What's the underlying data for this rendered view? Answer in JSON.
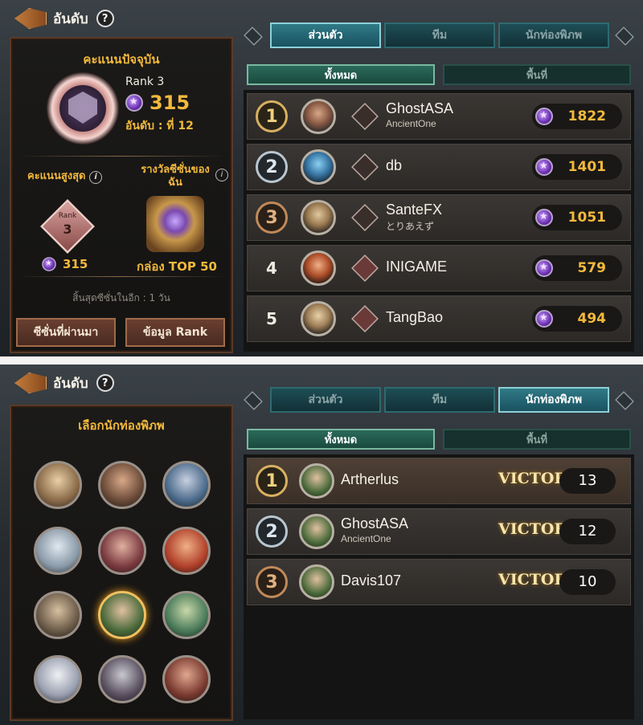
{
  "colors": {
    "gold": "#f3b93c",
    "tab_active": "#2f7a86",
    "victory": "#f6e6b0"
  },
  "icons": {
    "back": "back-arrow-icon",
    "help": "question-icon",
    "currency": "purple-star-gem-icon"
  },
  "panel1": {
    "header": {
      "title": "อันดับ",
      "help": "?"
    },
    "current_score_title": "คะแนนปัจจุบัน",
    "rank_label": "Rank 3",
    "score": "315",
    "position": "อันดับ : ที่ 12",
    "highest_score_label": "คะแนนสูงสุด",
    "season_reward_label": "รางวัลซีซั่นของฉัน",
    "info": "i",
    "badge_rank_label": "Rank",
    "badge_rank_number": "3",
    "highest_score": "315",
    "reward_name": "กล่อง TOP 50",
    "season_end": "สิ้นสุดซีซั่นในอีก : 1 วัน",
    "btn_past_seasons": "ซีซั่นที่ผ่านมา",
    "btn_rank_info": "ข้อมูล Rank",
    "tabs": [
      "ส่วนตัว",
      "ทีม",
      "นักท่องพิภพ"
    ],
    "subtabs": [
      "ทั้งหมด",
      "พื้นที่"
    ],
    "rows": [
      {
        "rank": "1",
        "name": "GhostASA",
        "sub": "AncientOne",
        "score": "1822"
      },
      {
        "rank": "2",
        "name": "db",
        "sub": "",
        "score": "1401"
      },
      {
        "rank": "3",
        "name": "SanteFX",
        "sub": "とりあえず",
        "score": "1051"
      },
      {
        "rank": "4",
        "name": "INIGAME",
        "sub": "",
        "score": "579"
      },
      {
        "rank": "5",
        "name": "TangBao",
        "sub": "",
        "score": "494"
      }
    ]
  },
  "panel2": {
    "header": {
      "title": "อันดับ",
      "help": "?"
    },
    "select_title": "เลือกนักท่องพิภพ",
    "tabs": [
      "ส่วนตัว",
      "ทีม",
      "นักท่องพิภพ"
    ],
    "subtabs": [
      "ทั้งหมด",
      "พื้นที่"
    ],
    "rows": [
      {
        "rank": "1",
        "name": "Artherlus",
        "sub": "",
        "victory": "VICTORY",
        "score": "13"
      },
      {
        "rank": "2",
        "name": "GhostASA",
        "sub": "AncientOne",
        "victory": "VICTORY",
        "score": "12"
      },
      {
        "rank": "3",
        "name": "Davis107",
        "sub": "",
        "victory": "VICTORY",
        "score": "10"
      }
    ]
  }
}
